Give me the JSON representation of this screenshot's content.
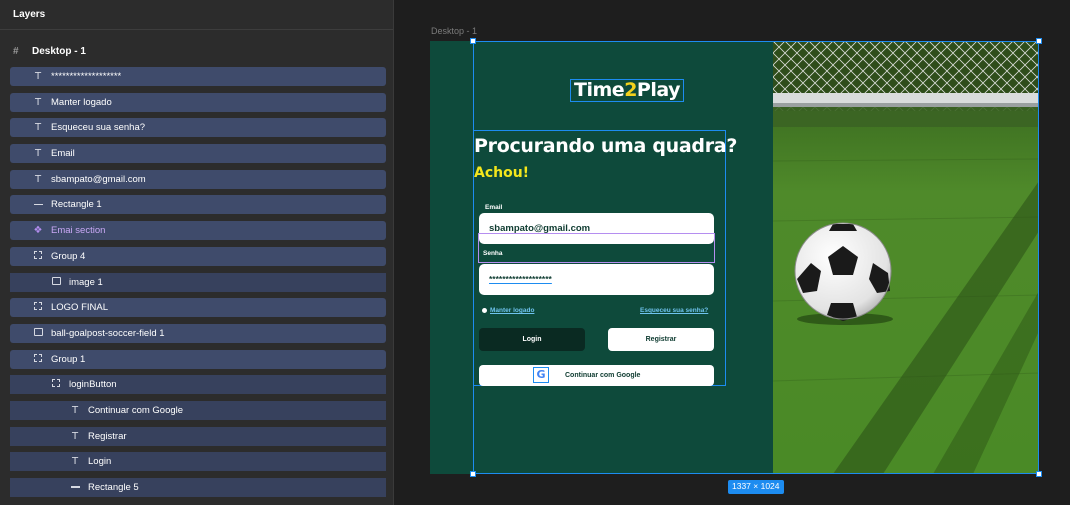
{
  "layers_panel": {
    "title": "Layers",
    "root": {
      "label": "Desktop - 1",
      "icon": "frame-icon"
    },
    "rows": [
      {
        "label": "*******************",
        "icon": "text-icon",
        "kind": "text",
        "level": 0
      },
      {
        "label": "Manter logado",
        "icon": "text-icon",
        "kind": "text",
        "level": 0
      },
      {
        "label": "Esqueceu sua senha?",
        "icon": "text-icon",
        "kind": "text",
        "level": 0
      },
      {
        "label": "Email",
        "icon": "text-icon",
        "kind": "text",
        "level": 0
      },
      {
        "label": "sbampato@gmail.com",
        "icon": "text-icon",
        "kind": "text",
        "level": 0
      },
      {
        "label": "Rectangle 1",
        "icon": "line-icon",
        "kind": "line",
        "level": 0
      },
      {
        "label": "Emai section",
        "icon": "component-icon",
        "kind": "component",
        "level": 0
      },
      {
        "label": "Group 4",
        "icon": "group-icon",
        "kind": "group",
        "level": 0
      },
      {
        "label": "image 1",
        "icon": "image-icon",
        "kind": "image",
        "level": 1
      },
      {
        "label": "LOGO FINAL",
        "icon": "group-icon",
        "kind": "group",
        "level": 0
      },
      {
        "label": "ball-goalpost-soccer-field 1",
        "icon": "image-icon",
        "kind": "image",
        "level": 0
      },
      {
        "label": "Group 1",
        "icon": "group-icon",
        "kind": "group",
        "level": 0
      },
      {
        "label": "loginButton",
        "icon": "group-icon",
        "kind": "group",
        "level": 1
      },
      {
        "label": "Continuar com Google",
        "icon": "text-icon",
        "kind": "text",
        "level": 2
      },
      {
        "label": "Registrar",
        "icon": "text-icon",
        "kind": "text",
        "level": 2
      },
      {
        "label": "Login",
        "icon": "text-icon",
        "kind": "text",
        "level": 2
      },
      {
        "label": "Rectangle 5",
        "icon": "line-icon",
        "kind": "line",
        "level": 2
      }
    ]
  },
  "canvas": {
    "frame_label": "Desktop - 1",
    "size_badge": "1337 × 1024",
    "selection_color": "#1d8cf0",
    "frame_bg": "#0e4a3b",
    "design": {
      "logo_part1": "Time",
      "logo_part2": "2",
      "logo_part3": "Play",
      "headline": "Procurando uma quadra?",
      "subheadline": "Achou!",
      "email_label": "Email",
      "email_value": "sbampato@gmail.com",
      "password_label": "Senha",
      "password_value": "*******************",
      "keep_logged": "Manter logado",
      "forgot_password": "Esqueceu sua senha?",
      "login_button": "Login",
      "register_button": "Registrar",
      "google_button": "Continuar com Google",
      "google_icon": "google-g-icon",
      "accent_yellow": "#f4e61c"
    }
  }
}
